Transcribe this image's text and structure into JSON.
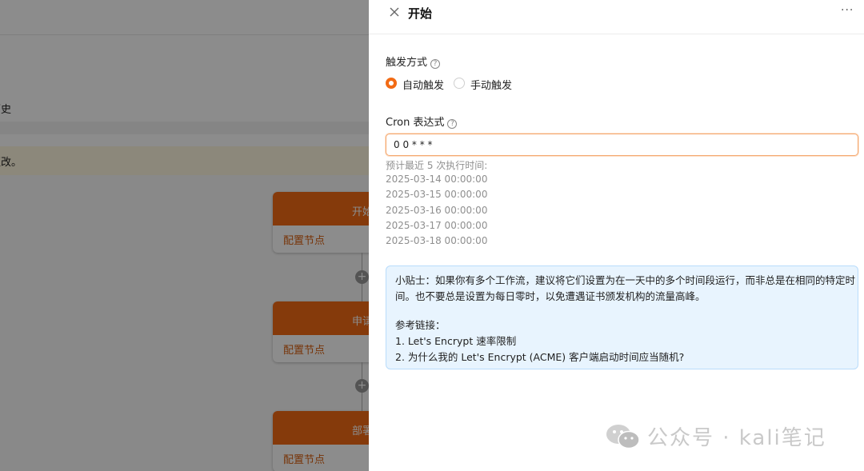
{
  "background": {
    "history_tab": "历史",
    "notice_text": "更改。",
    "nodes": [
      {
        "title": "开始",
        "action": "配置节点"
      },
      {
        "title": "申请",
        "action": "配置节点"
      },
      {
        "title": "部署",
        "action": "配置节点"
      }
    ],
    "add_symbol": "+"
  },
  "drawer": {
    "title": "开始",
    "more": "···",
    "trigger": {
      "label": "触发方式",
      "options": [
        {
          "label": "自动触发",
          "checked": true
        },
        {
          "label": "手动触发",
          "checked": false
        }
      ]
    },
    "cron": {
      "label": "Cron 表达式",
      "value": "0 0 * * *"
    },
    "preview": {
      "heading": "预计最近 5 次执行时间:",
      "times": [
        "2025-03-14 00:00:00",
        "2025-03-15 00:00:00",
        "2025-03-16 00:00:00",
        "2025-03-17 00:00:00",
        "2025-03-18 00:00:00"
      ]
    },
    "tip": {
      "line1": "小贴士：如果你有多个工作流，建议将它们设置为在一天中的多个时间段运行，而非总是在相同的特定时",
      "line2": "间。也不要总是设置为每日零时，以免遭遇证书颁发机构的流量高峰。",
      "links_heading": "参考链接：",
      "links": [
        "1. Let's Encrypt 速率限制",
        "2. 为什么我的 Let's Encrypt (ACME) 客户端启动时间应当随机?"
      ]
    }
  },
  "watermark": {
    "text": "公众号 · kali笔记"
  },
  "colors": {
    "accent": "#f26b15",
    "tip_bg": "#e8f4fe",
    "tip_border": "#b9dcfb"
  }
}
